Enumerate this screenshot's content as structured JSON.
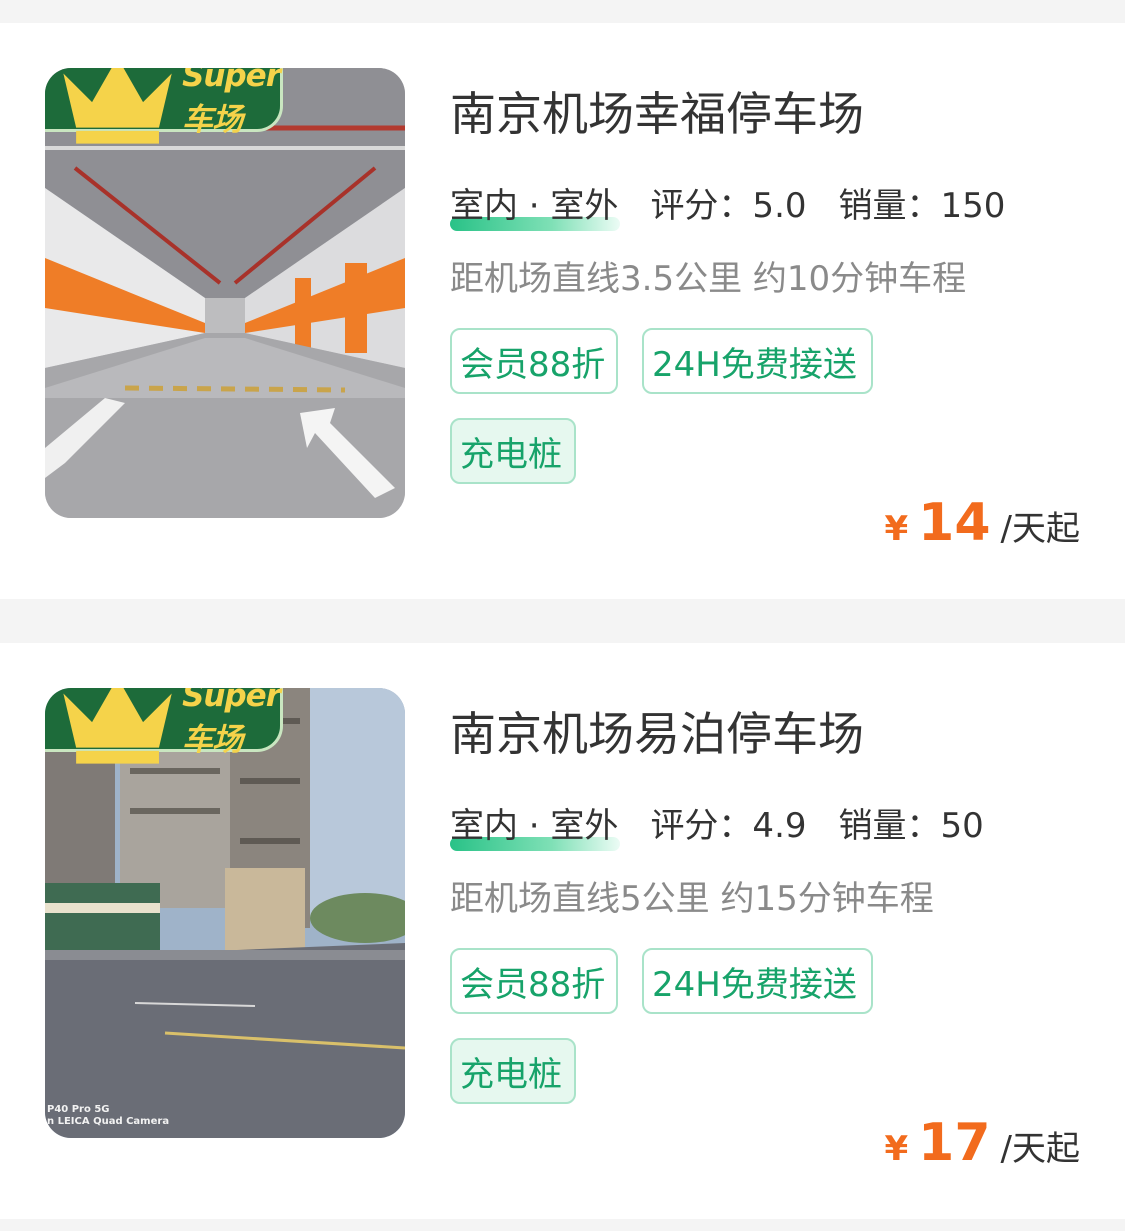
{
  "colors": {
    "badge_bg": "#1d6b3a",
    "badge_text": "#f5d34a",
    "tag_text": "#17a36a",
    "tag_border": "#a9e3c9",
    "price": "#f26b1d"
  },
  "listings": [
    {
      "badge": {
        "icon": "crown-icon",
        "text": "Super车场"
      },
      "image": "underground-parking-garage",
      "title": "南京机场幸福停车场",
      "type_label": "室内 · 室外",
      "rating_label": "评分：5.0",
      "sales_label": "销量：150",
      "distance": "距机场直线3.5公里 约10分钟车程",
      "tags": [
        "会员88折",
        "24H免费接送",
        "充电桩"
      ],
      "price": {
        "currency": "¥",
        "amount": "14",
        "unit": "/天起"
      }
    },
    {
      "badge": {
        "icon": "crown-icon",
        "text": "Super车场"
      },
      "image": "outdoor-street-parking",
      "photo_caption": "P40 Pro 5G\nn LEICA Quad Camera",
      "title": "南京机场易泊停车场",
      "type_label": "室内 · 室外",
      "rating_label": "评分：4.9",
      "sales_label": "销量：50",
      "distance": "距机场直线5公里 约15分钟车程",
      "tags": [
        "会员88折",
        "24H免费接送",
        "充电桩"
      ],
      "price": {
        "currency": "¥",
        "amount": "17",
        "unit": "/天起"
      }
    }
  ]
}
